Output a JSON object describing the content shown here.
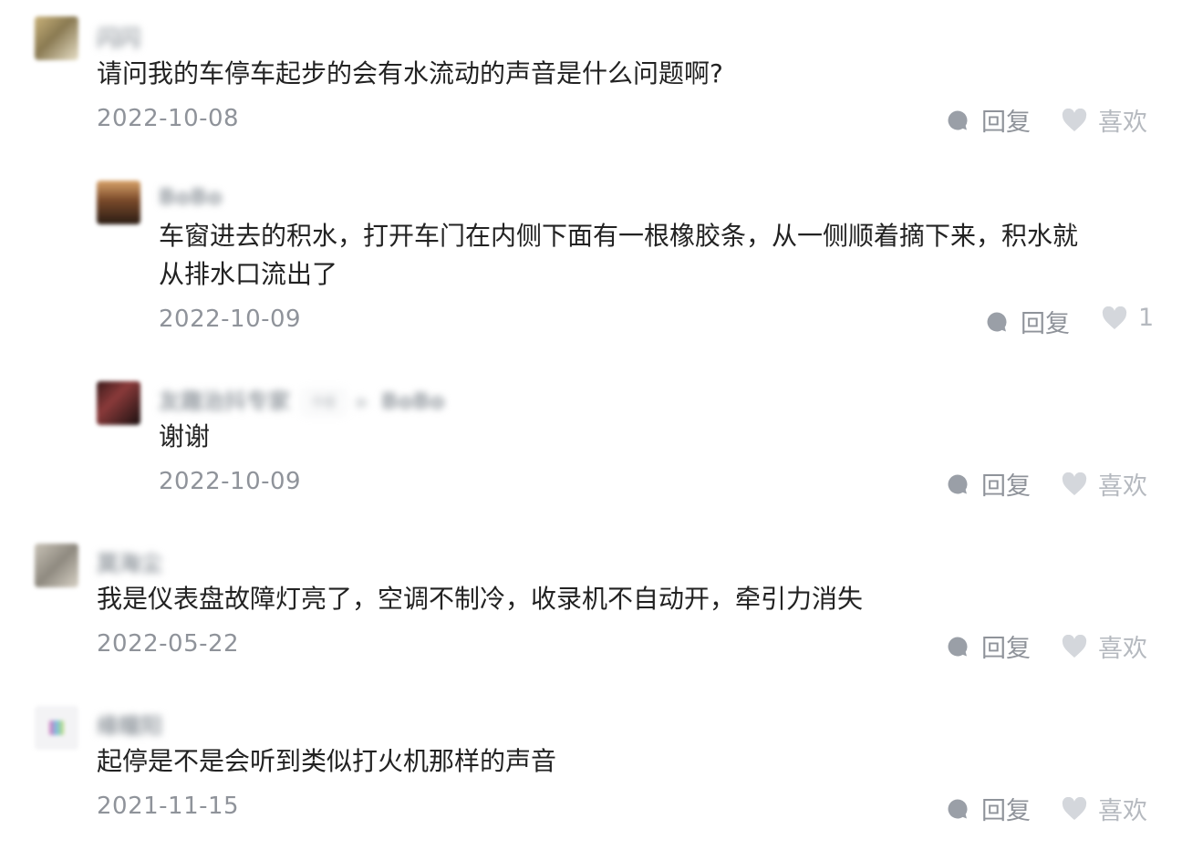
{
  "labels": {
    "reply": "回复",
    "like": "喜欢"
  },
  "comments": [
    {
      "name": "闪闪",
      "text": "请问我的车停车起步的会有水流动的声音是什么问题啊?",
      "date": "2022-10-08",
      "likes": "喜欢"
    },
    {
      "name": "BoBo",
      "text": "车窗进去的积水，打开车门在内侧下面有一根橡胶条，从一侧顺着摘下来，积水就\n从排水口流出了",
      "date": "2022-10-09",
      "likes": "1"
    },
    {
      "name": "友趣治抖专家",
      "tag": "作者",
      "reply_to": "BoBo",
      "text": "谢谢",
      "date": "2022-10-09",
      "likes": "喜欢"
    },
    {
      "name": "莫海尘",
      "text": "我是仪表盘故障灯亮了，空调不制冷，收录机不自动开，牵引力消失",
      "date": "2022-05-22",
      "likes": "喜欢"
    },
    {
      "name": "缘瞳阳",
      "text": "起停是不是会听到类似打火机那样的声音",
      "date": "2021-11-15",
      "likes": "喜欢"
    }
  ],
  "colors": {
    "icon": "#9a9fa7",
    "heart": "#d4d7dc",
    "text_muted": "#8f939a"
  }
}
